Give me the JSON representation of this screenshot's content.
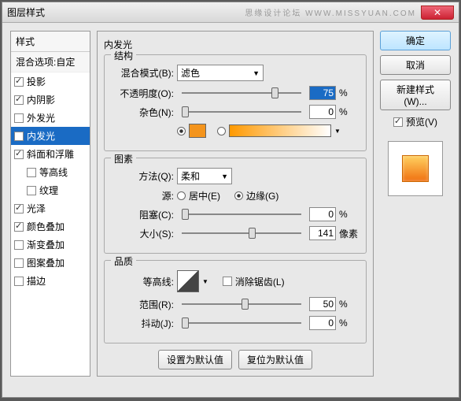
{
  "window": {
    "title": "图层样式",
    "watermark": "思缘设计论坛 WWW.MISSYUAN.COM"
  },
  "sidebar": {
    "header": "样式",
    "blending": "混合选项:自定",
    "items": [
      {
        "label": "投影",
        "checked": true
      },
      {
        "label": "内阴影",
        "checked": true
      },
      {
        "label": "外发光",
        "checked": false
      },
      {
        "label": "内发光",
        "checked": true,
        "active": true
      },
      {
        "label": "斜面和浮雕",
        "checked": true
      },
      {
        "label": "等高线",
        "checked": false,
        "indent": true
      },
      {
        "label": "纹理",
        "checked": false,
        "indent": true
      },
      {
        "label": "光泽",
        "checked": true
      },
      {
        "label": "颜色叠加",
        "checked": true
      },
      {
        "label": "渐变叠加",
        "checked": false
      },
      {
        "label": "图案叠加",
        "checked": false
      },
      {
        "label": "描边",
        "checked": false
      }
    ]
  },
  "panel": {
    "title": "内发光",
    "structure": {
      "label": "结构",
      "blendmode_label": "混合模式(B):",
      "blendmode_value": "滤色",
      "opacity_label": "不透明度(O):",
      "opacity_value": "75",
      "opacity_unit": "%",
      "noise_label": "杂色(N):",
      "noise_value": "0",
      "noise_unit": "%",
      "color": "#f4941c"
    },
    "elements": {
      "label": "图素",
      "technique_label": "方法(Q):",
      "technique_value": "柔和",
      "source_label": "源:",
      "center_label": "居中(E)",
      "edge_label": "边缘(G)",
      "choke_label": "阻塞(C):",
      "choke_value": "0",
      "choke_unit": "%",
      "size_label": "大小(S):",
      "size_value": "141",
      "size_unit": "像素"
    },
    "quality": {
      "label": "品质",
      "contour_label": "等高线:",
      "anti_label": "消除锯齿(L)",
      "range_label": "范围(R):",
      "range_value": "50",
      "range_unit": "%",
      "jitter_label": "抖动(J):",
      "jitter_value": "0",
      "jitter_unit": "%"
    },
    "defaults": {
      "make": "设置为默认值",
      "reset": "复位为默认值"
    }
  },
  "buttons": {
    "ok": "确定",
    "cancel": "取消",
    "newstyle": "新建样式(W)...",
    "preview": "预览(V)"
  }
}
